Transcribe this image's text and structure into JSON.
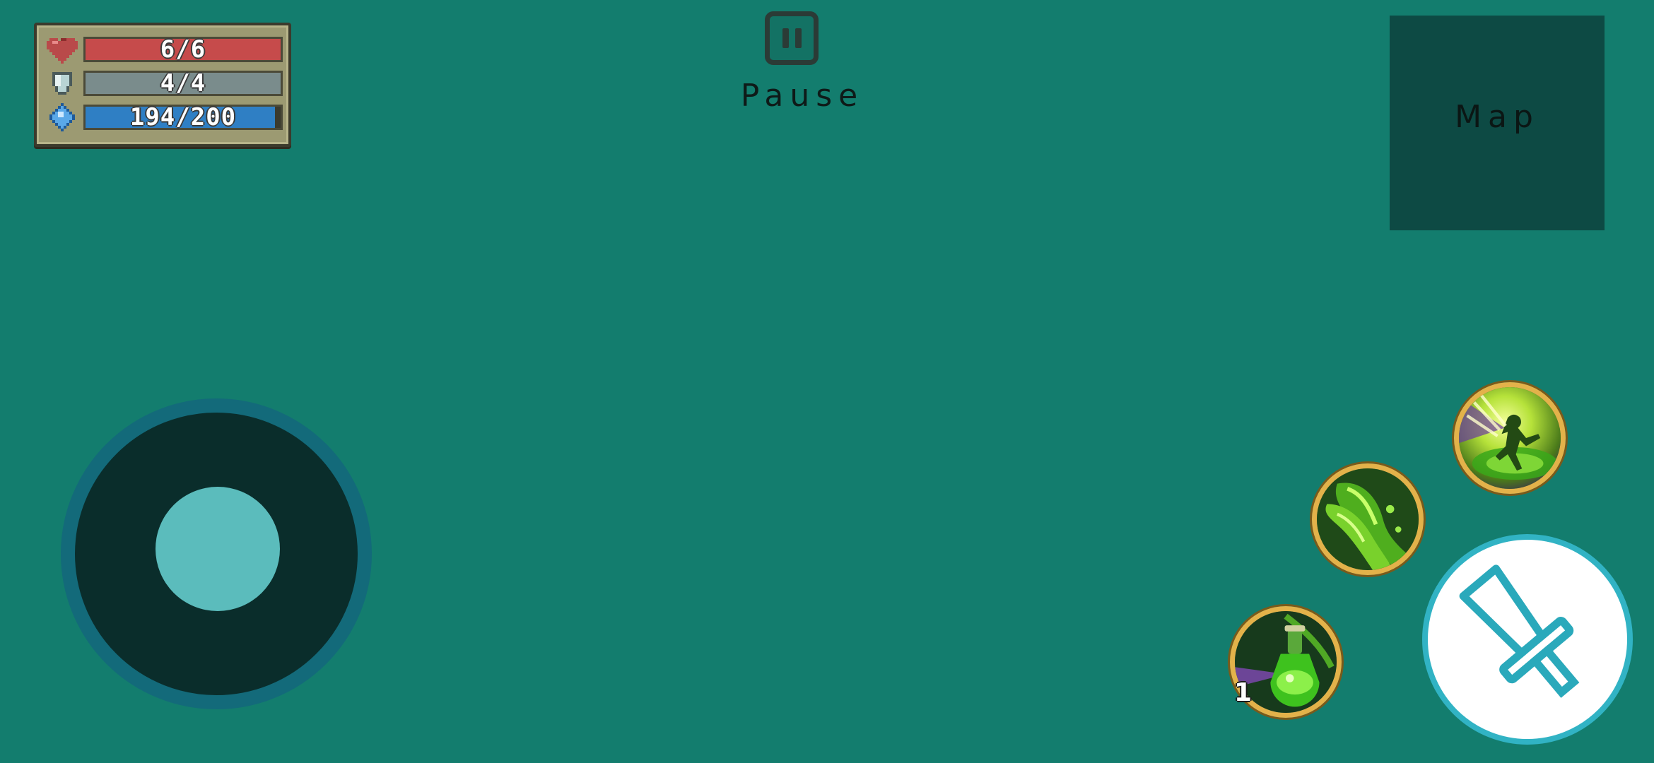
{
  "stats": {
    "health": {
      "text": "6/6",
      "current": 6,
      "max": 6,
      "color": "#c64b4b",
      "icon": "heart-icon"
    },
    "armor": {
      "text": "4/4",
      "current": 4,
      "max": 4,
      "color": "#7a8c8c",
      "icon": "shield-icon"
    },
    "energy": {
      "text": "194/200",
      "current": 194,
      "max": 200,
      "color": "#2f7fc4",
      "icon": "diamond-icon"
    }
  },
  "pause": {
    "label": "Pause",
    "icon": "pause-icon"
  },
  "map": {
    "label": "Map"
  },
  "skills": {
    "dash": {
      "icon": "dash-skill-icon"
    },
    "slime": {
      "icon": "slime-skill-icon"
    },
    "potion": {
      "icon": "potion-skill-icon",
      "count": "1"
    }
  },
  "attack": {
    "icon": "sword-icon"
  },
  "colors": {
    "background": "#137d6e",
    "map_panel": "#0d4a44",
    "joystick_base": "#0a2d2b",
    "joystick_ring": "#136a7a",
    "joystick_knob": "#5bbcbc",
    "attack_border": "#31b3c4",
    "skill_ring": "#e3b24a"
  }
}
